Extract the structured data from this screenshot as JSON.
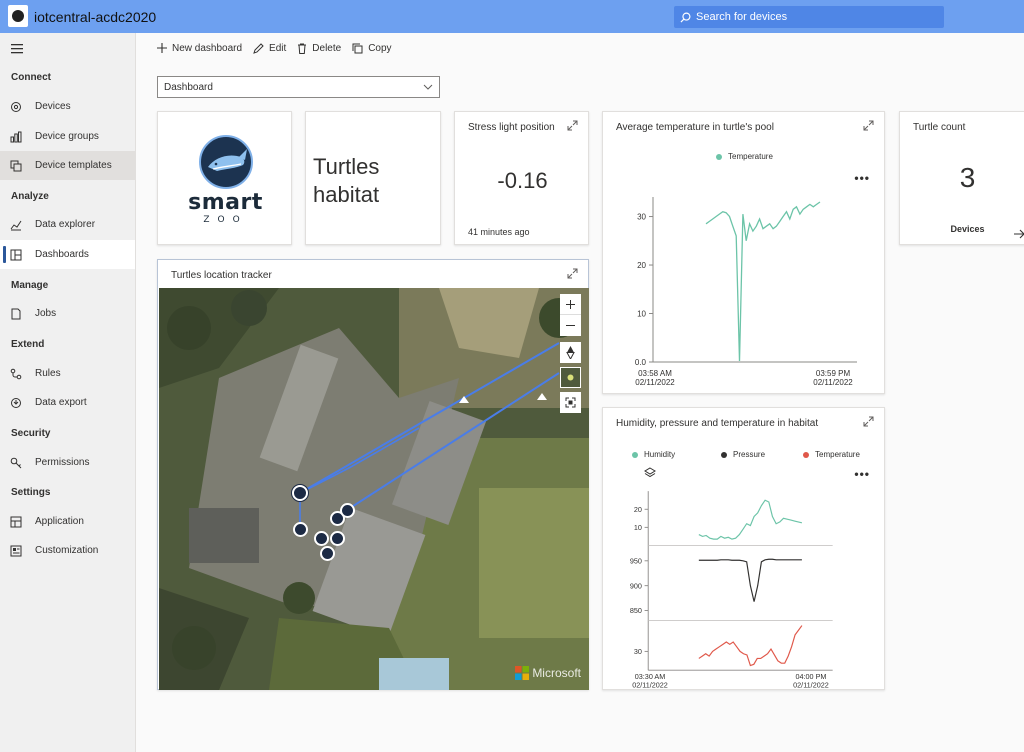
{
  "app": {
    "title": "iotcentral-acdc2020"
  },
  "search": {
    "placeholder": "Search for devices"
  },
  "sidebar": {
    "groups": [
      {
        "label": "Connect"
      },
      {
        "label": "Analyze"
      },
      {
        "label": "Manage"
      },
      {
        "label": "Extend"
      },
      {
        "label": "Security"
      },
      {
        "label": "Settings"
      }
    ],
    "items": [
      {
        "label": "Devices",
        "icon": "devices-icon"
      },
      {
        "label": "Device groups",
        "icon": "device-groups-icon"
      },
      {
        "label": "Device templates",
        "icon": "device-templates-icon"
      },
      {
        "label": "Data explorer",
        "icon": "data-explorer-icon"
      },
      {
        "label": "Dashboards",
        "icon": "dashboards-icon"
      },
      {
        "label": "Jobs",
        "icon": "jobs-icon"
      },
      {
        "label": "Rules",
        "icon": "rules-icon"
      },
      {
        "label": "Data export",
        "icon": "data-export-icon"
      },
      {
        "label": "Permissions",
        "icon": "permissions-icon"
      },
      {
        "label": "Application",
        "icon": "application-icon"
      },
      {
        "label": "Customization",
        "icon": "customization-icon"
      }
    ],
    "selected": "Dashboards",
    "highlighted": "Device templates"
  },
  "toolbar": {
    "new_dashboard": "New dashboard",
    "edit": "Edit",
    "delete": "Delete",
    "copy": "Copy"
  },
  "dashboard_select": {
    "value": "Dashboard"
  },
  "tiles": {
    "logo": {
      "line1": "smart",
      "line2": "ZOO"
    },
    "habitat": {
      "line1": "Turtles",
      "line2": "habitat"
    },
    "stress": {
      "title": "Stress light position",
      "value": "-0.16",
      "timestamp": "41 minutes ago"
    },
    "avg_temp": {
      "title": "Average temperature in turtle's pool",
      "legend": "Temperature",
      "more": "•••"
    },
    "count": {
      "title": "Turtle count",
      "value": "3",
      "unit": "Devices"
    },
    "tracker": {
      "title": "Turtles location tracker",
      "attribution": "Microsoft"
    },
    "humidity": {
      "title": "Humidity, pressure and temperature in habitat",
      "more": "•••",
      "legend": [
        "Humidity",
        "Pressure",
        "Temperature"
      ]
    }
  },
  "colors": {
    "humidity": "#6cc4a8",
    "pressure": "#323130",
    "temperature": "#e0584a",
    "accent": "#2b579a",
    "topbar": "#6da0f0"
  },
  "chart_data": [
    {
      "type": "line",
      "title": "Average temperature in turtle's pool",
      "series": [
        {
          "name": "Temperature",
          "color": "#6cc4a8",
          "x": [
            "03:58:00",
            "03:58:05",
            "03:58:10",
            "03:58:15",
            "03:58:20",
            "03:58:25",
            "03:58:30",
            "03:58:35",
            "03:58:40",
            "03:58:42",
            "03:58:44",
            "03:58:46",
            "03:58:48",
            "03:58:50",
            "03:58:52",
            "03:58:55",
            "03:58:58",
            "03:59:00",
            "03:59:02",
            "03:59:05",
            "03:59:08",
            "03:59:10",
            "03:59:12",
            "03:59:15",
            "03:59:18",
            "03:59:20",
            "03:59:25",
            "03:59:30",
            "03:59:35",
            "03:59:40",
            "03:59:45",
            "03:59:50",
            "03:59:55",
            "04:00:00",
            "04:00:02"
          ],
          "values": [
            28.5,
            29.0,
            29.5,
            30.0,
            30.5,
            31.0,
            30.8,
            30.0,
            28.0,
            26.0,
            0.2,
            30.5,
            25.0,
            28.5,
            27.0,
            28.0,
            29.5,
            27.5,
            28.0,
            28.5,
            27.5,
            28.0,
            29.0,
            30.0,
            31.0,
            29.5,
            31.5,
            32.0,
            30.5,
            31.5,
            32.0,
            32.5,
            32.0,
            32.5,
            33.0
          ]
        }
      ],
      "x_ticks": [
        {
          "line1": "03:58 AM",
          "line2": "02/11/2022"
        },
        {
          "line1": "03:59 PM",
          "line2": "02/11/2022"
        }
      ],
      "y_ticks": [
        "0.0",
        "10",
        "20",
        "30"
      ],
      "ylim": [
        0,
        33
      ]
    },
    {
      "type": "line",
      "title": "Humidity, pressure and temperature in habitat",
      "series": [
        {
          "name": "Humidity",
          "color": "#6cc4a8",
          "ylim": [
            0,
            30
          ],
          "y_ticks": [
            "10",
            "20"
          ],
          "values": [
            6,
            5,
            5.5,
            4,
            3.5,
            3.5,
            5,
            4,
            4.5,
            3.5,
            4,
            6,
            9,
            12,
            11,
            16,
            18,
            22,
            25,
            24,
            16,
            12,
            13,
            15,
            14.5,
            14,
            13.5,
            13,
            12.5
          ]
        },
        {
          "name": "Pressure",
          "color": "#323130",
          "ylim": [
            830,
            970
          ],
          "y_ticks": [
            "850",
            "900",
            "950"
          ],
          "values": [
            951,
            951,
            951,
            951,
            951,
            951,
            952,
            952,
            952,
            951,
            951,
            951,
            950,
            948,
            900,
            868,
            900,
            948,
            952,
            953,
            953,
            952,
            952,
            952,
            952,
            952,
            952,
            952,
            952
          ]
        },
        {
          "name": "Temperature",
          "color": "#e0584a",
          "ylim": [
            22,
            42
          ],
          "y_ticks": [
            "30"
          ],
          "values": [
            27,
            28,
            29,
            28,
            30,
            31,
            32,
            33,
            34,
            33,
            34,
            32,
            30,
            29,
            28.5,
            24,
            24.5,
            27,
            27,
            28,
            29,
            31,
            28.5,
            26,
            25,
            25,
            28,
            32,
            37,
            39,
            41
          ]
        }
      ],
      "x_ticks": [
        {
          "line1": "03:30 AM",
          "line2": "02/11/2022"
        },
        {
          "line1": "04:00 PM",
          "line2": "02/11/2022"
        }
      ]
    }
  ]
}
